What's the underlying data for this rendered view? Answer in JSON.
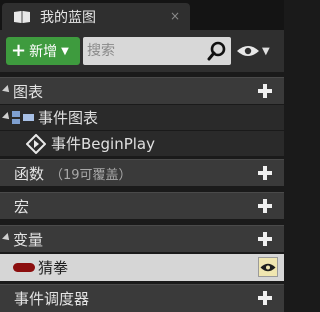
{
  "tab": {
    "title": "我的蓝图",
    "close": "×"
  },
  "toolbar": {
    "add_label": "新增",
    "search_placeholder": "搜索"
  },
  "sections": {
    "graphs": {
      "title": "图表"
    },
    "event_graph": {
      "label": "事件图表"
    },
    "begin_play": {
      "label": "事件BeginPlay"
    },
    "functions": {
      "title": "函数",
      "subtitle": "（19可覆盖）"
    },
    "macros": {
      "title": "宏"
    },
    "variables": {
      "title": "变量"
    },
    "variable_item": {
      "label": "猜拳"
    },
    "dispatchers": {
      "title": "事件调度器"
    }
  },
  "colors": {
    "accent_green": "#3e9b3e",
    "variable_pin": "#8b0e0e"
  }
}
